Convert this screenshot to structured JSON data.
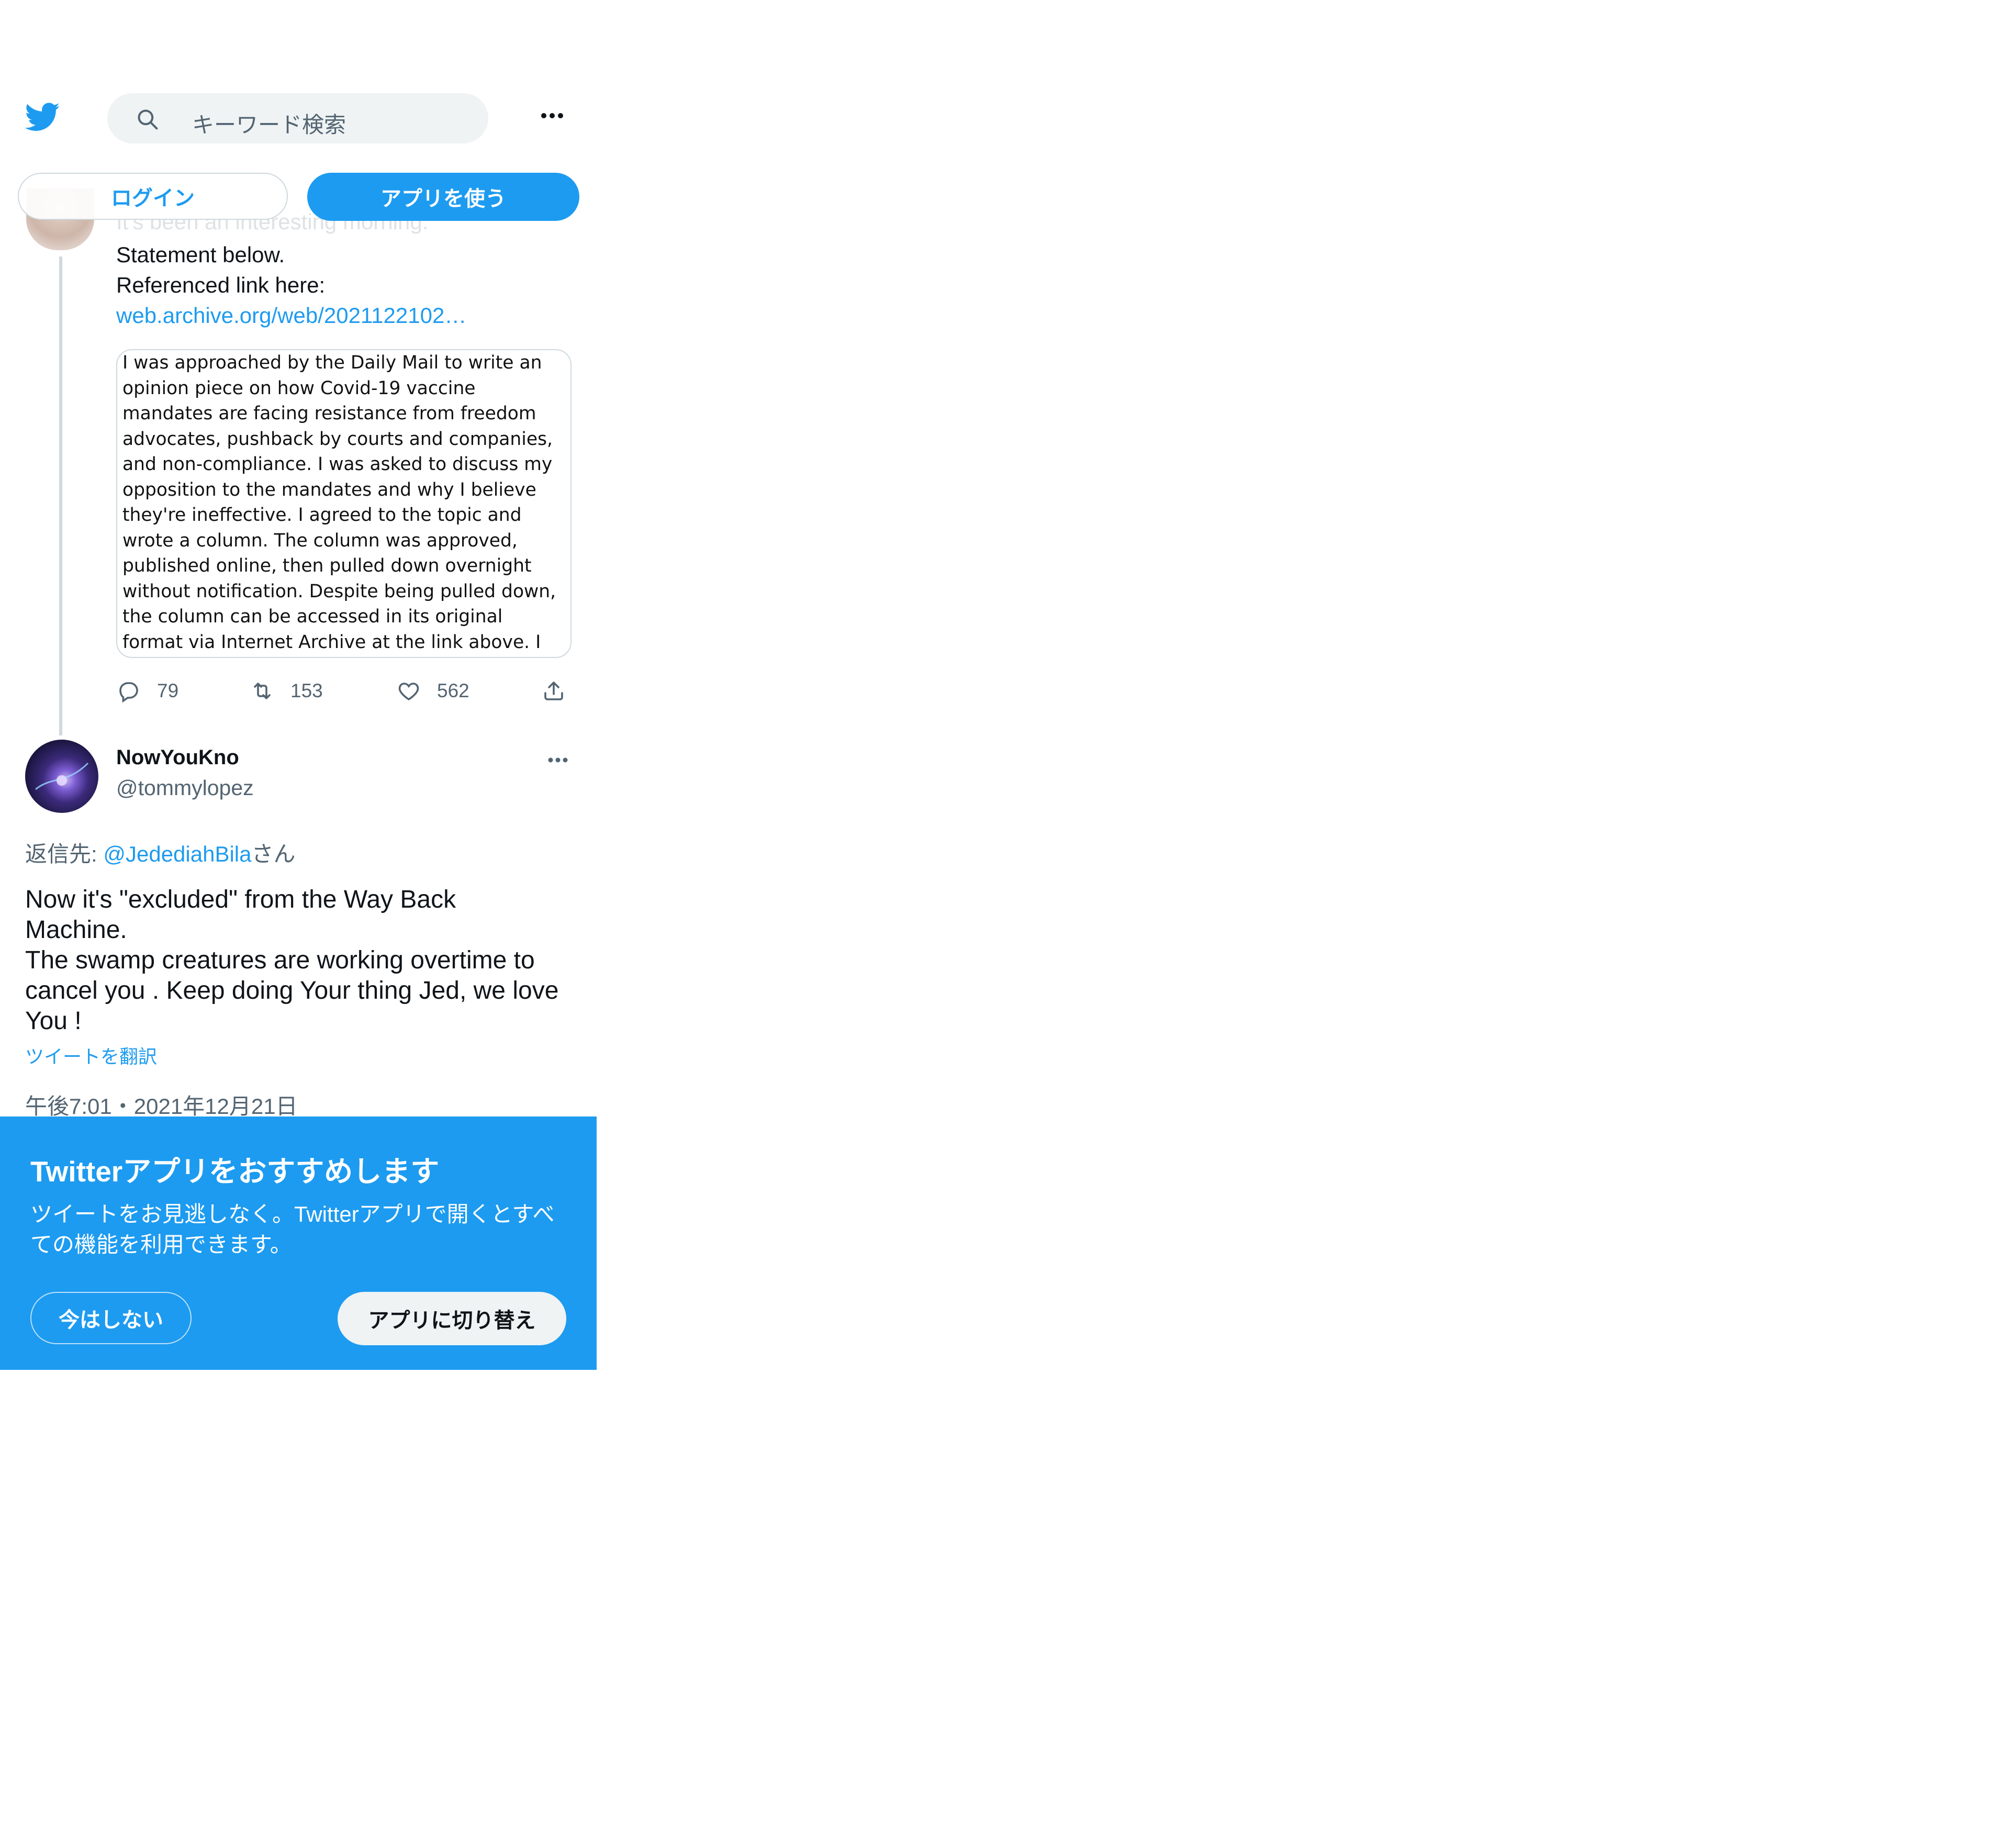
{
  "colors": {
    "accent": "#1d9bf0",
    "text": "#0f1419",
    "muted": "#536471",
    "border": "#cfd9de"
  },
  "topbar": {
    "logo_icon": "twitter-bird-icon",
    "search_placeholder": "キーワード検索",
    "more_icon": "more-horizontal-icon"
  },
  "auth": {
    "login_label": "ログイン",
    "use_app_label": "アプリを使う"
  },
  "tweet1": {
    "faded_line": "It's been an interesting morning.",
    "text_lines": [
      "Statement below.",
      "Referenced link here:"
    ],
    "link": "web.archive.org/web/2021122102…",
    "image_text": "I was approached by the Daily Mail to write an opinion piece on how Covid-19 vaccine mandates are facing resistance from freedom advocates, pushback by courts and companies, and non-compliance. I was asked to discuss my opposition to the mandates and why I believe they're ineffective. I agreed to the topic and wrote a column. The column was approved, published online, then pulled down overnight without notification. Despite being pulled down, the column can be accessed in its original format via Internet Archive at the link above. I hope that you'll give it a read.",
    "replies": "79",
    "retweets": "153",
    "likes": "562"
  },
  "tweet2": {
    "name": "NowYouKno",
    "handle": "@tommylopez",
    "reply_prefix": "返信先: ",
    "reply_mention": "@JedediahBila",
    "reply_suffix": "さん",
    "text": "Now it's \"excluded\" from the Way Back Machine.\nThe swamp creatures are working overtime to cancel you . Keep doing Your thing Jed, we love You !",
    "translate_label": "ツイートを翻訳",
    "timestamp": "午後7:01・2021年12月21日"
  },
  "banner": {
    "title": "Twitterアプリをおすすめします",
    "description": "ツイートをお見逃しなく。Twitterアプリで開くとすべての機能を利用できます。",
    "not_now_label": "今はしない",
    "switch_label": "アプリに切り替え"
  }
}
